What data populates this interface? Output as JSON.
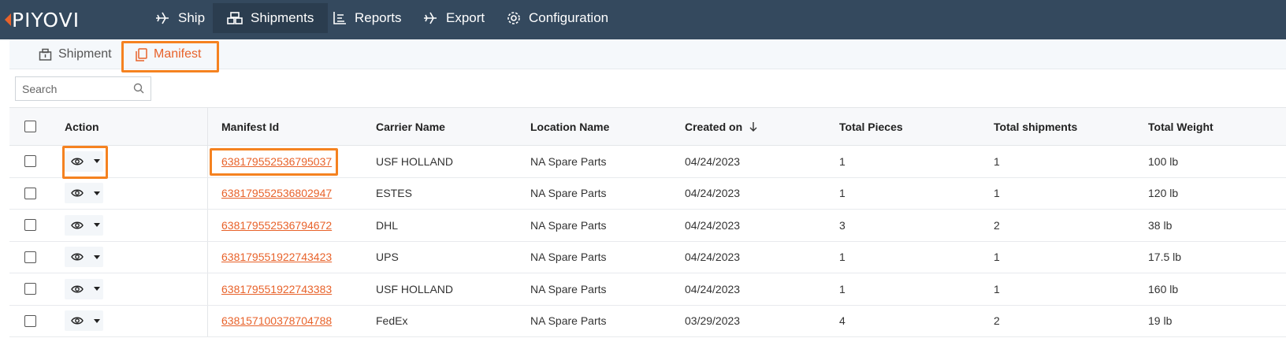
{
  "app": {
    "logo_text": "PIYOVI"
  },
  "colors": {
    "nav_bg": "#34495e",
    "accent": "#e8622a",
    "highlight": "#f58220"
  },
  "nav": [
    {
      "label": "Ship",
      "icon": "plane-icon"
    },
    {
      "label": "Shipments",
      "icon": "boxes-icon",
      "active": true
    },
    {
      "label": "Reports",
      "icon": "chart-icon"
    },
    {
      "label": "Export",
      "icon": "export-plane-icon"
    },
    {
      "label": "Configuration",
      "icon": "gear-icon"
    }
  ],
  "subtabs": [
    {
      "label": "Shipment",
      "icon": "package-icon"
    },
    {
      "label": "Manifest",
      "icon": "copy-icon",
      "active": true
    }
  ],
  "search": {
    "placeholder": "Search",
    "value": ""
  },
  "table": {
    "headers": {
      "action": "Action",
      "manifest_id": "Manifest Id",
      "carrier": "Carrier Name",
      "location": "Location Name",
      "created": "Created on",
      "pieces": "Total Pieces",
      "shipments": "Total shipments",
      "weight": "Total Weight"
    },
    "sort": {
      "column": "created",
      "direction": "desc"
    },
    "rows": [
      {
        "manifest_id": "638179552536795037",
        "carrier": "USF HOLLAND",
        "location": "NA Spare Parts",
        "created": "04/24/2023",
        "pieces": "1",
        "shipments": "1",
        "weight": "100 lb"
      },
      {
        "manifest_id": "638179552536802947",
        "carrier": "ESTES",
        "location": "NA Spare Parts",
        "created": "04/24/2023",
        "pieces": "1",
        "shipments": "1",
        "weight": "120 lb"
      },
      {
        "manifest_id": "638179552536794672",
        "carrier": "DHL",
        "location": "NA Spare Parts",
        "created": "04/24/2023",
        "pieces": "3",
        "shipments": "2",
        "weight": "38 lb"
      },
      {
        "manifest_id": "638179551922743423",
        "carrier": "UPS",
        "location": "NA Spare Parts",
        "created": "04/24/2023",
        "pieces": "1",
        "shipments": "1",
        "weight": "17.5 lb"
      },
      {
        "manifest_id": "638179551922743383",
        "carrier": "USF HOLLAND",
        "location": "NA Spare Parts",
        "created": "04/24/2023",
        "pieces": "1",
        "shipments": "1",
        "weight": "160 lb"
      },
      {
        "manifest_id": "638157100378704788",
        "carrier": "FedEx",
        "location": "NA Spare Parts",
        "created": "03/29/2023",
        "pieces": "4",
        "shipments": "2",
        "weight": "19 lb"
      }
    ]
  }
}
